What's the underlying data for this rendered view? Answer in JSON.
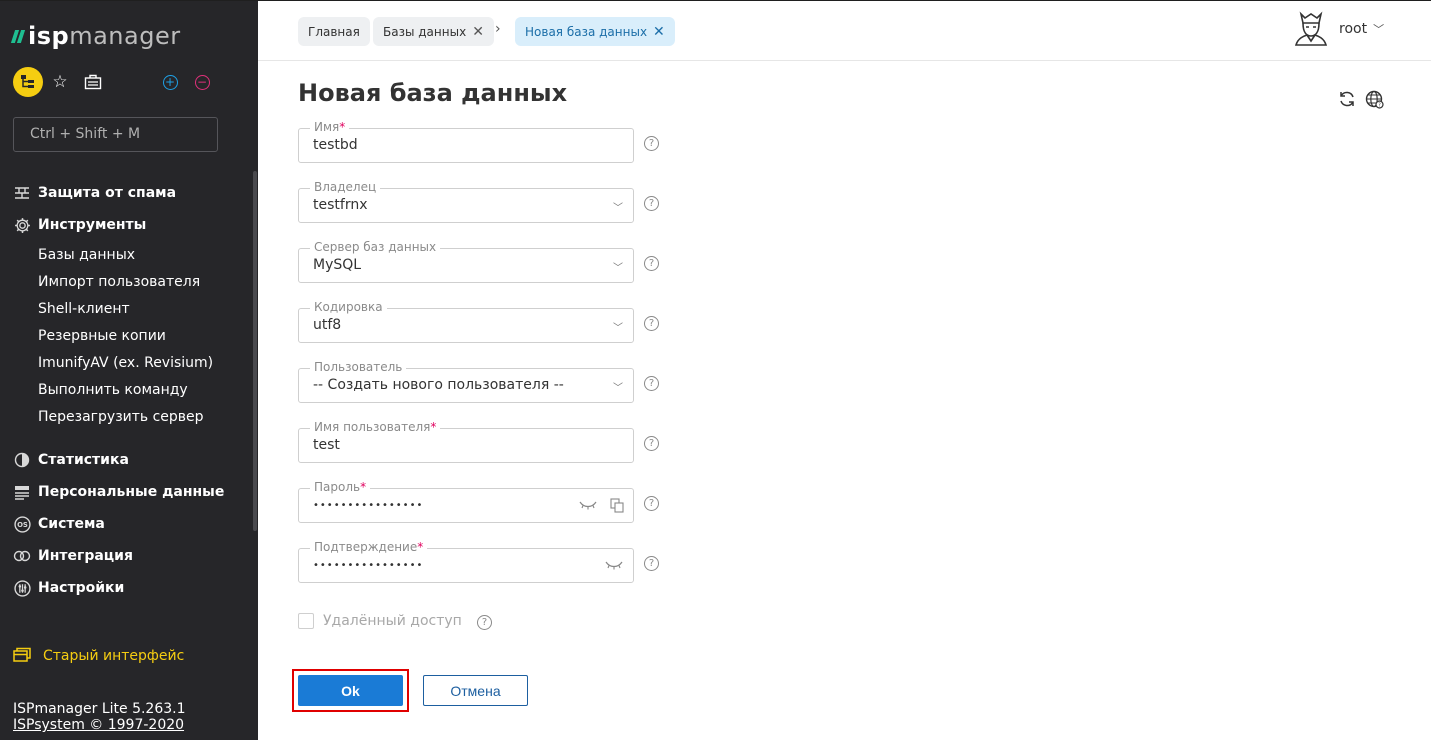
{
  "sidebar": {
    "logo": {
      "bold": "isp",
      "rest": "manager"
    },
    "search_placeholder": "Ctrl + Shift + M",
    "menu": [
      {
        "label": "Защита от спама",
        "icon": "firewall-icon"
      },
      {
        "label": "Инструменты",
        "icon": "gear-icon"
      }
    ],
    "submenu": [
      "Базы данных",
      "Импорт пользователя",
      "Shell-клиент",
      "Резервные копии",
      "ImunifyAV (ex. Revisium)",
      "Выполнить команду",
      "Перезагрузить сервер"
    ],
    "menu2": [
      {
        "label": "Статистика",
        "icon": "pie-chart-icon"
      },
      {
        "label": "Персональные данные",
        "icon": "id-card-icon"
      },
      {
        "label": "Система",
        "icon": "os-icon"
      },
      {
        "label": "Интеграция",
        "icon": "link-icon"
      },
      {
        "label": "Настройки",
        "icon": "sliders-icon"
      }
    ],
    "old_ui": "Старый интерфейс",
    "footer": {
      "version": "ISPmanager Lite 5.263.1",
      "copyright": "ISPsystem © 1997-2020"
    }
  },
  "breadcrumbs": [
    {
      "label": "Главная",
      "closable": false
    },
    {
      "label": "Базы данных",
      "closable": true
    },
    {
      "label": "Новая база данных",
      "closable": true,
      "active": true
    }
  ],
  "user": {
    "name": "root"
  },
  "page": {
    "title": "Новая база данных"
  },
  "form": {
    "fields": [
      {
        "label": "Имя",
        "required": true,
        "value": "testbd",
        "type": "text"
      },
      {
        "label": "Владелец",
        "required": false,
        "value": "testfrnx",
        "type": "select"
      },
      {
        "label": "Сервер баз данных",
        "required": false,
        "value": "MySQL",
        "type": "select"
      },
      {
        "label": "Кодировка",
        "required": false,
        "value": "utf8",
        "type": "select"
      },
      {
        "label": "Пользователь",
        "required": false,
        "value": "-- Создать нового пользователя --",
        "type": "select"
      },
      {
        "label": "Имя пользователя",
        "required": true,
        "value": "test",
        "type": "text"
      },
      {
        "label": "Пароль",
        "required": true,
        "value": "••••••••••••••••",
        "type": "password"
      },
      {
        "label": "Подтверждение",
        "required": true,
        "value": "••••••••••••••••",
        "type": "password"
      }
    ],
    "remote_access": {
      "label": "Удалённый доступ",
      "checked": false
    },
    "ok_label": "Ok",
    "cancel_label": "Отмена"
  },
  "colors": {
    "sidebar_bg": "#262629",
    "accent_yellow": "#f5cd11",
    "primary_button": "#1a7bd6",
    "required_mark": "#e0005e",
    "highlight_border": "#e00000"
  }
}
